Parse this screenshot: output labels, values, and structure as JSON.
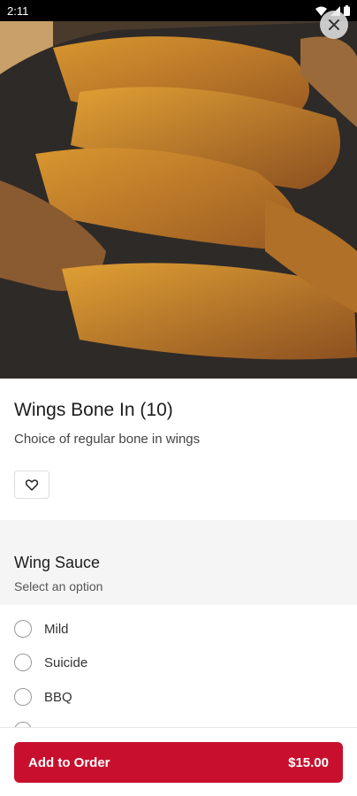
{
  "status_bar": {
    "time": "2:11"
  },
  "item": {
    "title": "Wings Bone In (10)",
    "description": "Choice of regular bone in wings"
  },
  "option_group": {
    "title": "Wing Sauce",
    "subtitle": "Select an option",
    "options": [
      {
        "label": "Mild"
      },
      {
        "label": "Suicide"
      },
      {
        "label": "BBQ"
      }
    ]
  },
  "add_button": {
    "label": "Add to Order",
    "price": "$15.00"
  },
  "colors": {
    "accent": "#c8102e"
  }
}
